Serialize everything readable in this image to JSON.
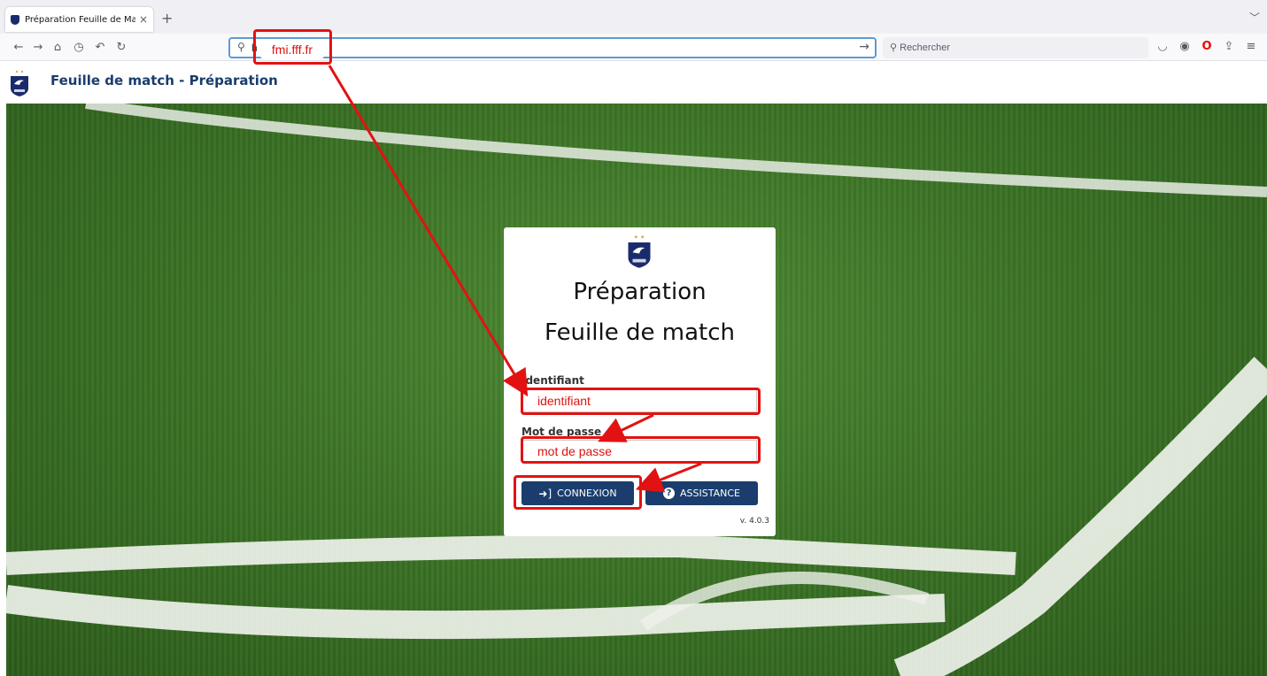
{
  "browser": {
    "tab_title": "Préparation Feuille de Match",
    "tab_close": "×",
    "new_tab": "+",
    "tab_list": "﹀",
    "url_prefix": "h",
    "url_annotation": "fmi.fff.fr",
    "search_placeholder": "Rechercher"
  },
  "site": {
    "header_title": "Feuille de match - Préparation"
  },
  "login": {
    "title_line1": "Préparation",
    "title_line2": "Feuille de match",
    "username_label": "Identifiant",
    "username_value": "identifiant",
    "password_label": "Mot de passe",
    "password_value": "mot de passe",
    "login_button": "CONNEXION",
    "help_button": "ASSISTANCE",
    "version": "v. 4.0.3"
  },
  "colors": {
    "brand_navy": "#1a3d6d",
    "annotation_red": "#e31212",
    "pitch_green": "#3c7426"
  }
}
